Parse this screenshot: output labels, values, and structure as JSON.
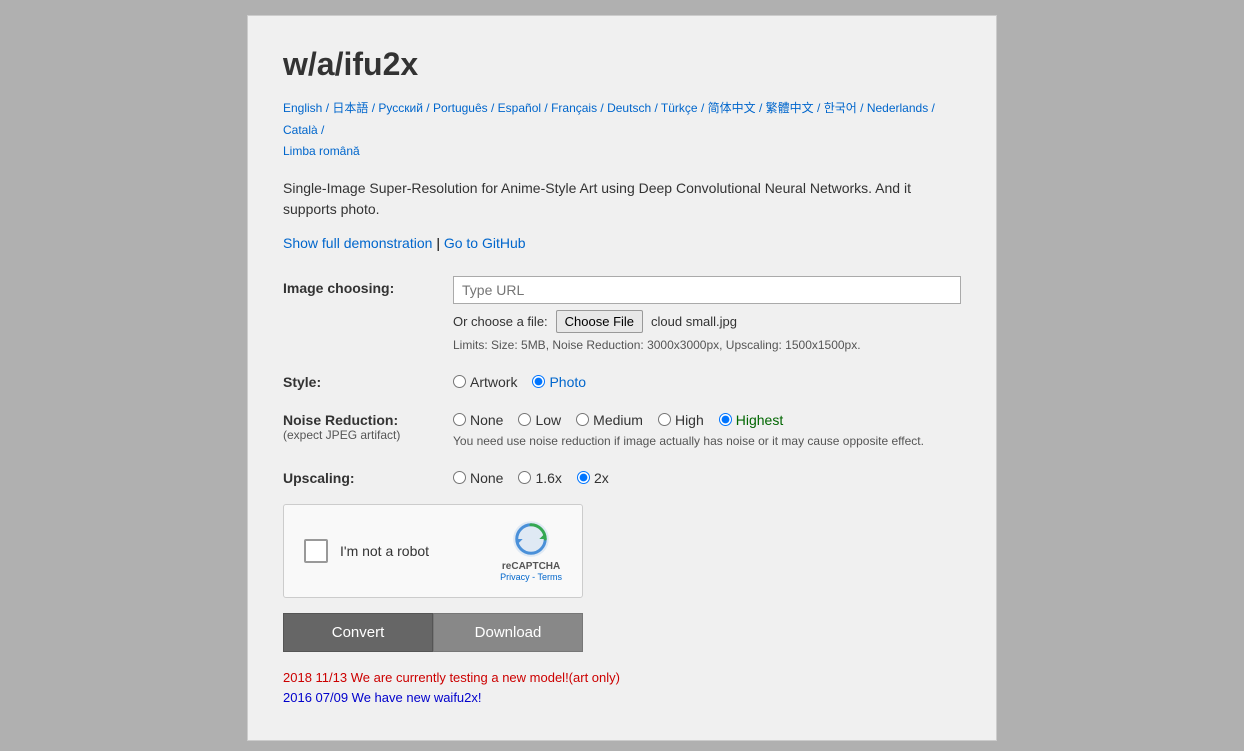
{
  "title": "w/a/ifu2x",
  "languages": [
    "English",
    "日本語",
    "Русский",
    "Português",
    "Español",
    "Français",
    "Deutsch",
    "Türkçe",
    "简体中文",
    "繁體中文",
    "한국어",
    "Nederlands",
    "Català",
    "Limba română"
  ],
  "description": "Single-Image Super-Resolution for Anime-Style Art using Deep Convolutional Neural Networks. And it supports photo.",
  "links": {
    "demo": "Show full demonstration",
    "github": "Go to GitHub"
  },
  "image_choosing": {
    "label": "Image choosing:",
    "url_placeholder": "Type URL",
    "file_label": "Or choose a file:",
    "choose_file_btn": "Choose File",
    "file_name": "cloud small.jpg",
    "limits": "Limits: Size: 5MB, Noise Reduction: 3000x3000px, Upscaling: 1500x1500px."
  },
  "style": {
    "label": "Style:",
    "options": [
      "Artwork",
      "Photo"
    ],
    "selected": "Photo"
  },
  "noise_reduction": {
    "label": "Noise Reduction:",
    "sublabel": "(expect JPEG artifact)",
    "options": [
      "None",
      "Low",
      "Medium",
      "High",
      "Highest"
    ],
    "selected": "Highest",
    "note": "You need use noise reduction if image actually has noise or it may cause opposite effect."
  },
  "upscaling": {
    "label": "Upscaling:",
    "options": [
      "None",
      "1.6x",
      "2x"
    ],
    "selected": "2x"
  },
  "captcha": {
    "label": "I'm not a robot",
    "brand": "reCAPTCHA",
    "links": "Privacy - Terms"
  },
  "buttons": {
    "convert": "Convert",
    "download": "Download"
  },
  "news": [
    {
      "text": "2018 11/13 We are currently testing a new model!(art only)",
      "color": "red"
    },
    {
      "text": "2016 07/09 We have new waifu2x!",
      "color": "blue"
    }
  ]
}
